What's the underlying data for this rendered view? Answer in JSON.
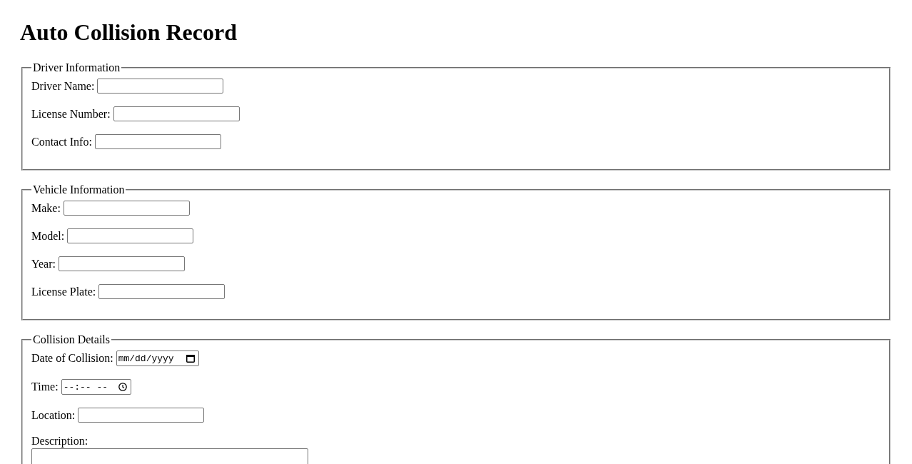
{
  "title": "Auto Collision Record",
  "sections": [
    {
      "legend": "Driver Information",
      "fields": [
        {
          "kind": "text",
          "label": "Driver Name:"
        },
        {
          "kind": "text",
          "label": "License Number:"
        },
        {
          "kind": "text",
          "label": "Contact Info:"
        }
      ]
    },
    {
      "legend": "Vehicle Information",
      "fields": [
        {
          "kind": "text",
          "label": "Make:"
        },
        {
          "kind": "text",
          "label": "Model:"
        },
        {
          "kind": "text",
          "label": "Year:"
        },
        {
          "kind": "text",
          "label": "License Plate:"
        }
      ]
    },
    {
      "legend": "Collision Details",
      "fields": [
        {
          "kind": "date",
          "label": "Date of Collision:",
          "placeholder": "mm/dd/yyyy"
        },
        {
          "kind": "time",
          "label": "Time:",
          "placeholder": "--:-- --"
        },
        {
          "kind": "text",
          "label": "Location:"
        },
        {
          "kind": "textarea",
          "label": "Description:"
        }
      ]
    }
  ]
}
